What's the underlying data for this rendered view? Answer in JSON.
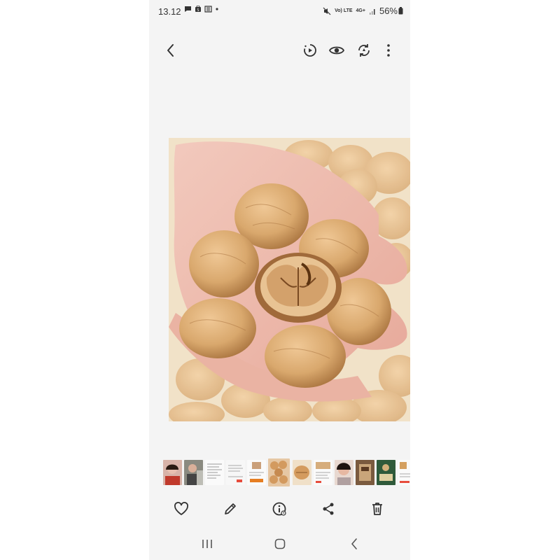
{
  "status_bar": {
    "time": "13.12",
    "battery": "56%",
    "volte_label": "Vo) LTE",
    "network_label": "4G+"
  },
  "top_bar": {
    "icons": [
      "back-icon",
      "motion-photo-icon",
      "view-icon",
      "remaster-icon",
      "more-options-icon"
    ]
  },
  "bottom_bar": {
    "icons": [
      "favorite-icon",
      "edit-icon",
      "details-icon",
      "share-icon",
      "delete-icon"
    ]
  },
  "nav_bar": {
    "icons": [
      "recent-apps-icon",
      "home-icon",
      "back-nav-icon"
    ]
  },
  "filmstrip": {
    "selected_index": 5
  },
  "colors": {
    "background": "#f4f4f4",
    "icon": "#333333",
    "walnut": "#d9a86d"
  }
}
